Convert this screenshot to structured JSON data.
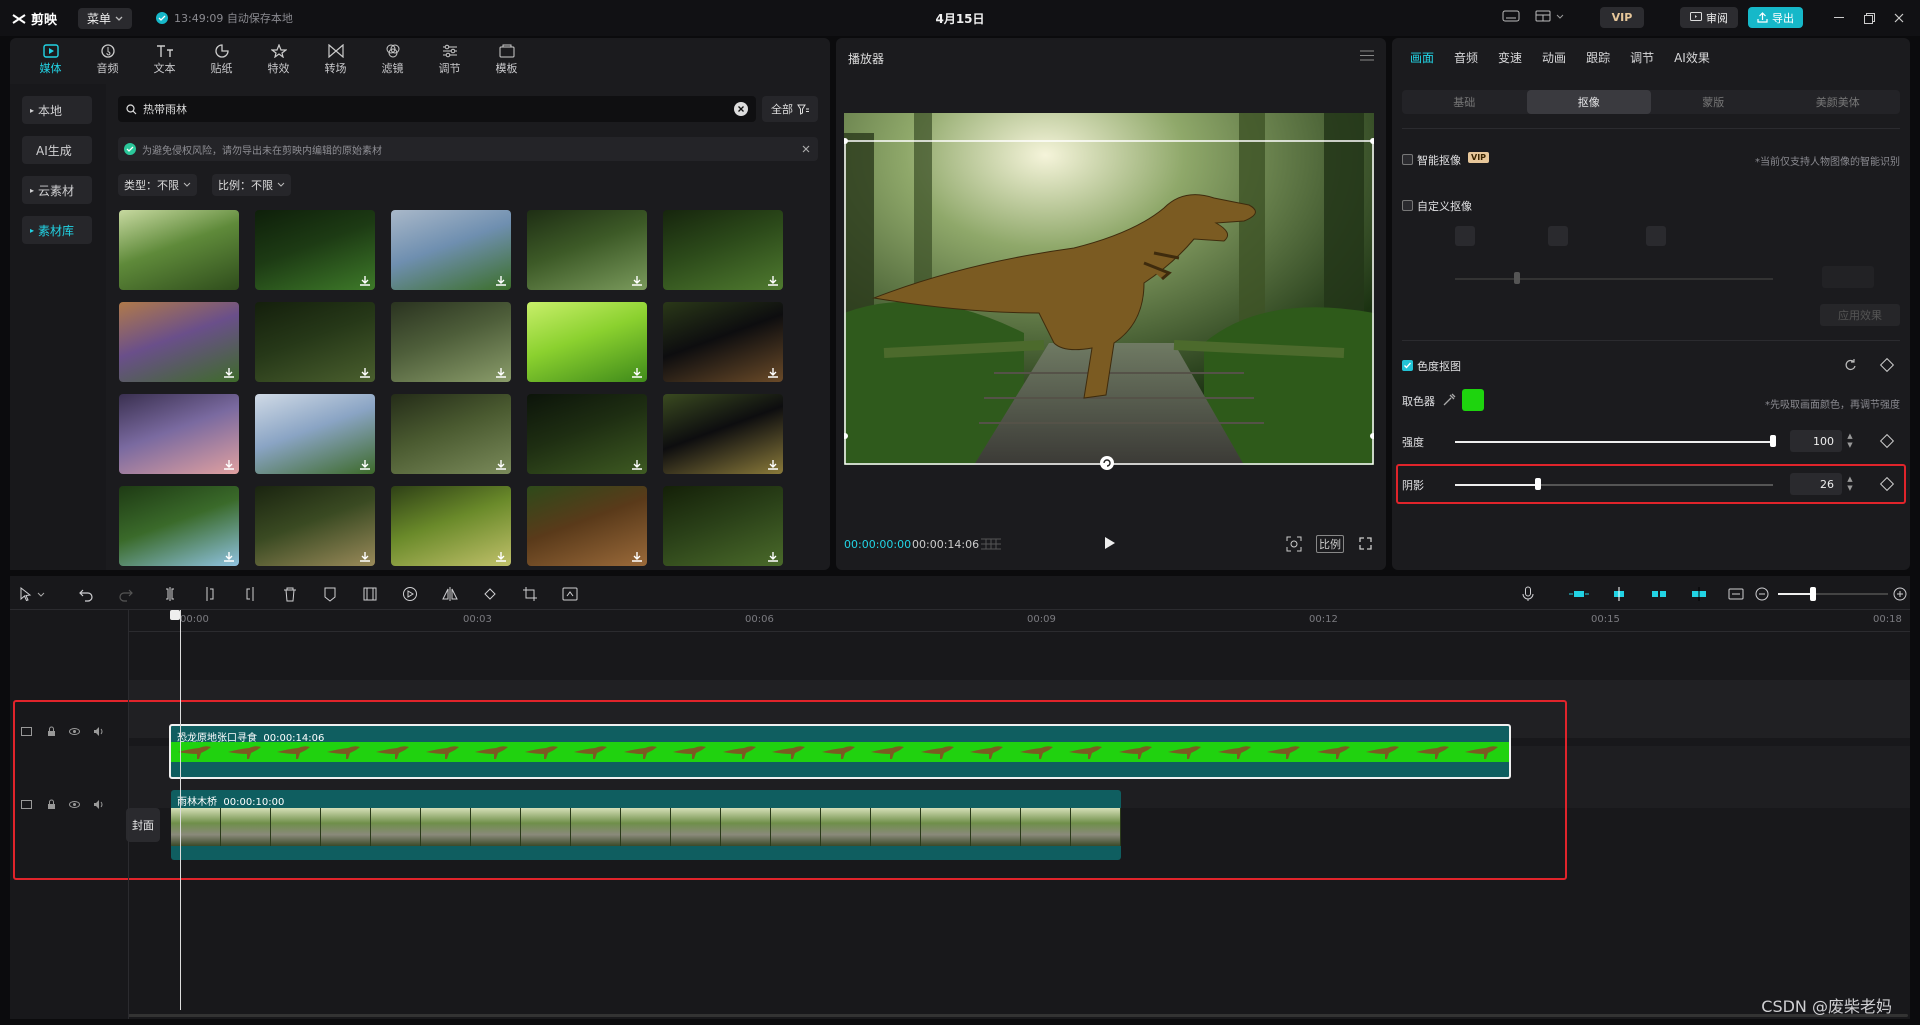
{
  "app": {
    "name": "剪映",
    "menu_label": "菜单",
    "autosave": "13:49:09 自动保存本地",
    "project_title": "4月15日",
    "vip_label": "VIP",
    "review_label": "审阅",
    "export_label": "导出"
  },
  "media_tabs": [
    {
      "label": "媒体",
      "icon": "media-icon"
    },
    {
      "label": "音频",
      "icon": "audio-icon"
    },
    {
      "label": "文本",
      "icon": "text-icon"
    },
    {
      "label": "贴纸",
      "icon": "sticker-icon"
    },
    {
      "label": "特效",
      "icon": "effects-icon"
    },
    {
      "label": "转场",
      "icon": "transition-icon"
    },
    {
      "label": "滤镜",
      "icon": "filter-icon"
    },
    {
      "label": "调节",
      "icon": "adjust-icon"
    },
    {
      "label": "模板",
      "icon": "template-icon"
    }
  ],
  "side_nav": [
    {
      "label": "本地"
    },
    {
      "label": "AI生成"
    },
    {
      "label": "云素材"
    },
    {
      "label": "素材库"
    }
  ],
  "search": {
    "value": "热带雨林",
    "filter_all": "全部"
  },
  "notice": "为避免侵权风险，请勿导出未在剪映内编辑的原始素材",
  "filters": {
    "type": "类型：不限",
    "ratio": "比例：不限"
  },
  "player": {
    "title": "播放器",
    "time_current": "00:00:00:00",
    "time_total": "00:00:14:06",
    "ratio_label": "比例"
  },
  "props": {
    "tabs": [
      "画面",
      "音频",
      "变速",
      "动画",
      "跟踪",
      "调节",
      "AI效果"
    ],
    "sub_tabs": [
      "基础",
      "抠像",
      "蒙版",
      "美颜美体"
    ],
    "smart_cutout": {
      "label": "智能抠像",
      "badge": "VIP",
      "hint": "*当前仅支持人物图像的智能识别"
    },
    "custom_cutout": {
      "label": "自定义抠像",
      "apply": "应用效果"
    },
    "chroma": {
      "label": "色度抠图",
      "picker_label": "取色器",
      "picker_color": "#1ed40e",
      "picker_hint": "*先吸取画面颜色，再调节强度",
      "strength_label": "强度",
      "strength_value": "100",
      "strength_pct": 1.0,
      "shadow_label": "阴影",
      "shadow_value": "26",
      "shadow_pct": 0.26
    }
  },
  "timeline": {
    "ruler": [
      "00:00",
      "00:03",
      "00:06",
      "00:09",
      "00:12",
      "00:15",
      "00:18"
    ],
    "tracks": [
      {
        "clip_name": "恐龙原地张口寻食",
        "clip_duration": "00:00:14:06"
      },
      {
        "clip_name": "雨林木桥",
        "clip_duration": "00:00:10:00"
      }
    ],
    "cover_label": "封面"
  },
  "watermark": "CSDN @废柴老妈",
  "colors": {
    "accent": "#22d3e4",
    "highlight": "#e0242b",
    "green_screen": "#1ed40e"
  }
}
